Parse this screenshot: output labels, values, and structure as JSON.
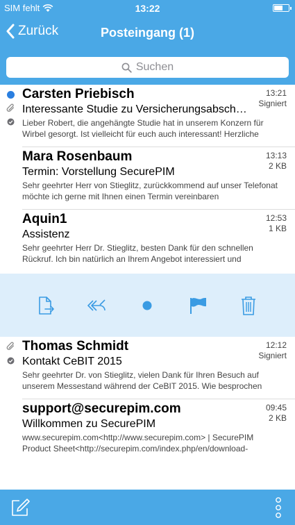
{
  "status_bar": {
    "carrier": "SIM fehlt",
    "time": "13:22"
  },
  "nav": {
    "back_label": "Zurück",
    "title": "Posteingang (1)"
  },
  "search": {
    "placeholder": "Suchen"
  },
  "emails": [
    {
      "sender": "Carsten Priebisch",
      "subject": "Interessante Studie zu Versicherungsabsch…",
      "preview": "Lieber Robert, die angehängte Studie hat in unserem Konzern für Wirbel gesorgt. Ist vielleicht für euch auch interessant! Herzliche",
      "time": "13:21",
      "meta": "Signiert",
      "unread": true,
      "attachment": true,
      "signed": true
    },
    {
      "sender": "Mara Rosenbaum",
      "subject": "Termin: Vorstellung SecurePIM",
      "preview": "Sehr geehrter Herr von Stieglitz, zurückkommend auf unser Telefonat möchte ich gerne mit Ihnen einen Termin vereinbaren",
      "time": "13:13",
      "meta": "2 KB",
      "unread": false,
      "attachment": false,
      "signed": false
    },
    {
      "sender": "Aquin1",
      "subject": "Assistenz",
      "preview": "Sehr geehrter Herr Dr. Stieglitz, besten Dank für den schnellen Rückruf. Ich bin natürlich an Ihrem Angebot interessiert und",
      "time": "12:53",
      "meta": "1 KB",
      "unread": false,
      "attachment": false,
      "signed": false
    },
    {
      "sender": "Thomas Schmidt",
      "subject": "Kontakt CeBIT 2015",
      "preview": "Sehr geehrter Dr. von Stieglitz, vielen Dank für Ihren Besuch auf unserem Messestand während der CeBIT 2015. Wie besprochen",
      "time": "12:12",
      "meta": "Signiert",
      "unread": false,
      "attachment": true,
      "signed": true
    },
    {
      "sender": "support@securepim.com",
      "subject": "Willkommen zu SecurePIM",
      "preview": "www.securepim.com<http://www.securepim.com> | SecurePIM Product Sheet<http://securepim.com/index.php/en/download-",
      "time": "09:45",
      "meta": "2 KB",
      "unread": false,
      "attachment": false,
      "signed": false
    }
  ],
  "swipe_actions": [
    {
      "icon": "move-document-icon"
    },
    {
      "icon": "reply-all-icon"
    },
    {
      "icon": "mark-unread-icon"
    },
    {
      "icon": "flag-icon"
    },
    {
      "icon": "trash-icon"
    }
  ],
  "toolbar": {
    "compose_icon": "compose-icon",
    "more_icon": "more-vertical-icon"
  },
  "colors": {
    "accent": "#4aa8e6",
    "unread": "#2a7fe0",
    "action_bg": "#ddeefb",
    "action_icon": "#3a9be3"
  }
}
